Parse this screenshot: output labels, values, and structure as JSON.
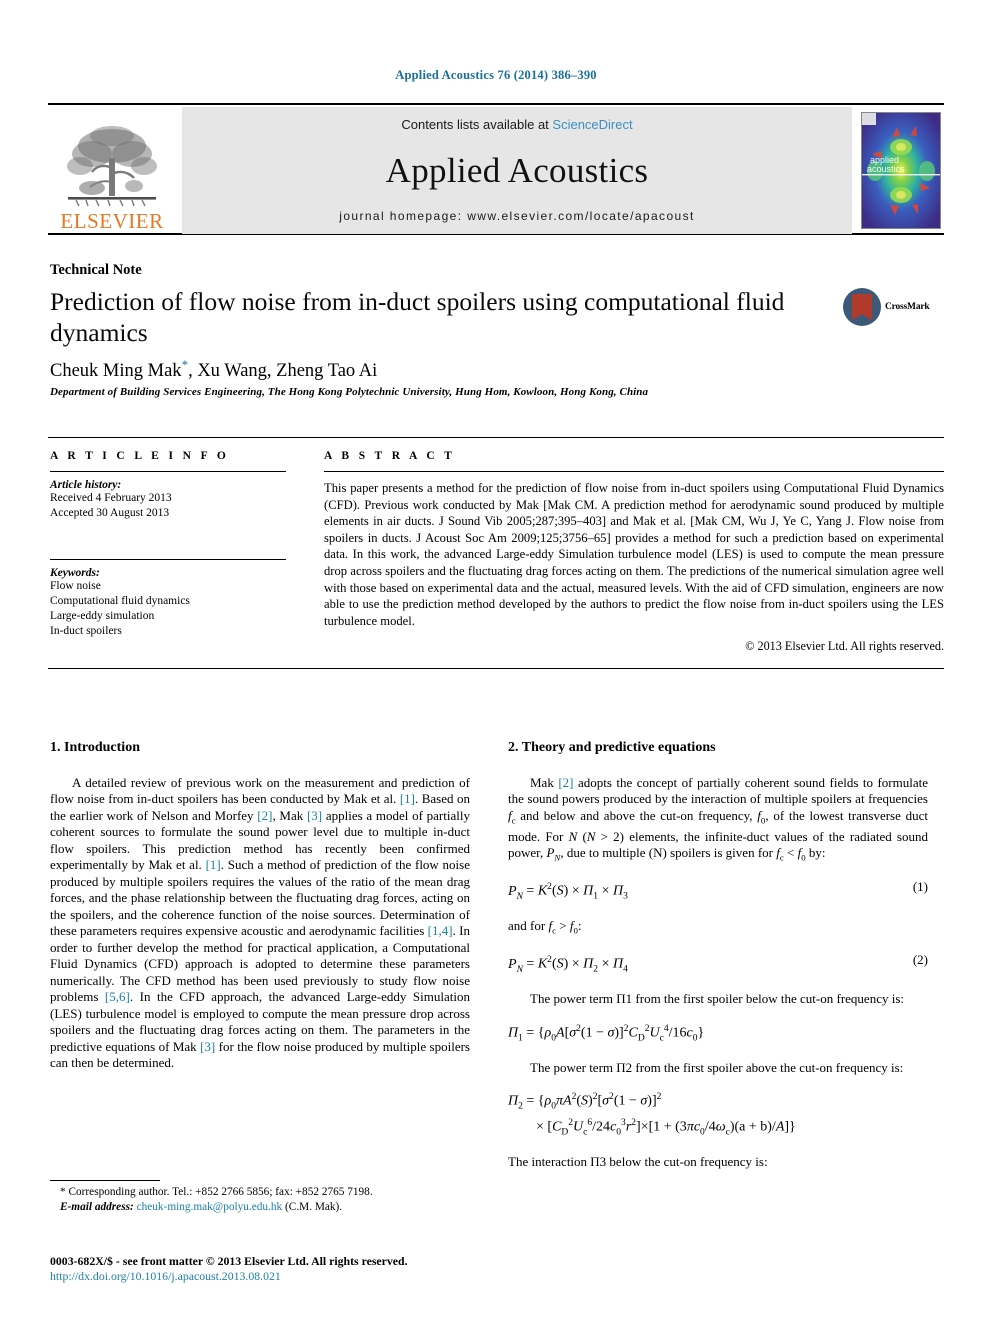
{
  "running_head": "Applied Acoustics 76 (2014) 386–390",
  "masthead": {
    "publisher_name": "ELSEVIER",
    "contents_prefix": "Contents lists available at ",
    "sciencedirect": "ScienceDirect",
    "journal_title": "Applied Acoustics",
    "homepage": "journal homepage: www.elsevier.com/locate/apacoust",
    "cover_line1": "applied",
    "cover_line2": "acoustics",
    "link_color": "#3a8fc4",
    "elsevier_orange": "#E87722"
  },
  "article": {
    "type": "Technical Note",
    "title": "Prediction of flow noise from in-duct spoilers using computational fluid dynamics",
    "authors": "Cheuk Ming Mak, Xu Wang, Zheng Tao Ai",
    "author_star": "*",
    "affiliation": "Department of Building Services Engineering, The Hong Kong Polytechnic University, Hung Hom, Kowloon, Hong Kong, China",
    "crossmark_label": "CrossMark"
  },
  "article_info": {
    "caption": "A R T I C L E   I N F O",
    "history_head": "Article history:",
    "history": [
      "Received 4 February 2013",
      "Accepted 30 August 2013"
    ],
    "keywords_head": "Keywords:",
    "keywords": [
      "Flow noise",
      "Computational fluid dynamics",
      "Large-eddy simulation",
      "In-duct spoilers"
    ]
  },
  "abstract": {
    "caption": "A B S T R A C T",
    "text": "This paper presents a method for the prediction of flow noise from in-duct spoilers using Computational Fluid Dynamics (CFD). Previous work conducted by Mak [Mak CM. A prediction method for aerodynamic sound produced by multiple elements in air ducts. J Sound Vib 2005;287;395–403] and Mak et al. [Mak CM, Wu J, Ye C, Yang J. Flow noise from spoilers in ducts. J Acoust Soc Am 2009;125;3756–65] provides a method for such a prediction based on experimental data. In this work, the advanced Large-eddy Simulation turbulence model (LES) is used to compute the mean pressure drop across spoilers and the fluctuating drag forces acting on them. The predictions of the numerical simulation agree well with those based on experimental data and the actual, measured levels. With the aid of CFD simulation, engineers are now able to use the prediction method developed by the authors to predict the flow noise from in-duct spoilers using the LES turbulence model.",
    "copyright": "© 2013 Elsevier Ltd. All rights reserved."
  },
  "sections": {
    "introduction": {
      "heading": "1. Introduction",
      "p1_a": "A detailed review of previous work on the measurement and prediction of flow noise from in-duct spoilers has been conducted by Mak et al. ",
      "r1": "[1]",
      "p1_b": ". Based on the earlier work of Nelson and Morfey ",
      "r2": "[2]",
      "p1_c": ", Mak ",
      "r3": "[3]",
      "p1_d": " applies a model of partially coherent sources to formulate the sound power level due to multiple in-duct flow spoilers. This prediction method has recently been confirmed experimentally by Mak et al. ",
      "r4": "[1]",
      "p1_e": ". Such a method of prediction of the flow noise produced by multiple spoilers requires the values of the ratio of the mean drag forces, and the phase relationship between the fluctuating drag forces, acting on the spoilers, and the coherence function of the noise sources. Determination of these parameters requires expensive acoustic and aerodynamic facilities ",
      "r5": "[1,4]",
      "p1_f": ". In order to further develop the method for practical application, a Computational Fluid Dynamics (CFD) approach is adopted to determine these parameters numerically. The CFD method has been used previously to study flow noise problems ",
      "r6": "[5,6]",
      "p1_g": ". In the CFD approach, the advanced Large-eddy Simulation (LES) turbulence model is employed to compute the mean pressure drop across spoilers and the fluctuating drag forces acting on them. The parameters in the predictive equations of Mak ",
      "r7": "[3]",
      "p1_h": " for the flow noise produced by multiple spoilers can then be determined."
    },
    "theory": {
      "heading": "2. Theory and predictive equations",
      "p1_a": "Mak ",
      "r1": "[2]",
      "p1_b": " adopts the concept of partially coherent sound fields to formulate the sound powers produced by the interaction of multiple spoilers at frequencies ",
      "p1_c": " and below and above the cut-on frequency, ",
      "p1_d": ", of the lowest transverse duct mode. For ",
      "p1_e": " elements, the infinite-duct values of the radiated sound power, ",
      "p1_f": ", due to multiple (N) spoilers is given for ",
      "p1_g": " by:",
      "eq1_num": "(1)",
      "between_eq": "and for",
      "eq2_num": "(2)",
      "lead_pi1": "The power term Π1 from the first spoiler below the cut-on frequency is:",
      "lead_pi2": "The power term Π2 from the first spoiler above the cut-on frequency is:",
      "lead_pi3": "The interaction Π3 below the cut-on frequency is:"
    }
  },
  "footnote": {
    "corresponding": "* Corresponding author. Tel.: +852 2766 5856; fax: +852 2765 7198.",
    "email_label": "E-mail address:",
    "email": "cheuk-ming.mak@polyu.edu.hk",
    "email_suffix": " (C.M. Mak)."
  },
  "footer": {
    "issn_line": "0003-682X/$ - see front matter © 2013 Elsevier Ltd. All rights reserved.",
    "doi": "http://dx.doi.org/10.1016/j.apacoust.2013.08.021"
  }
}
